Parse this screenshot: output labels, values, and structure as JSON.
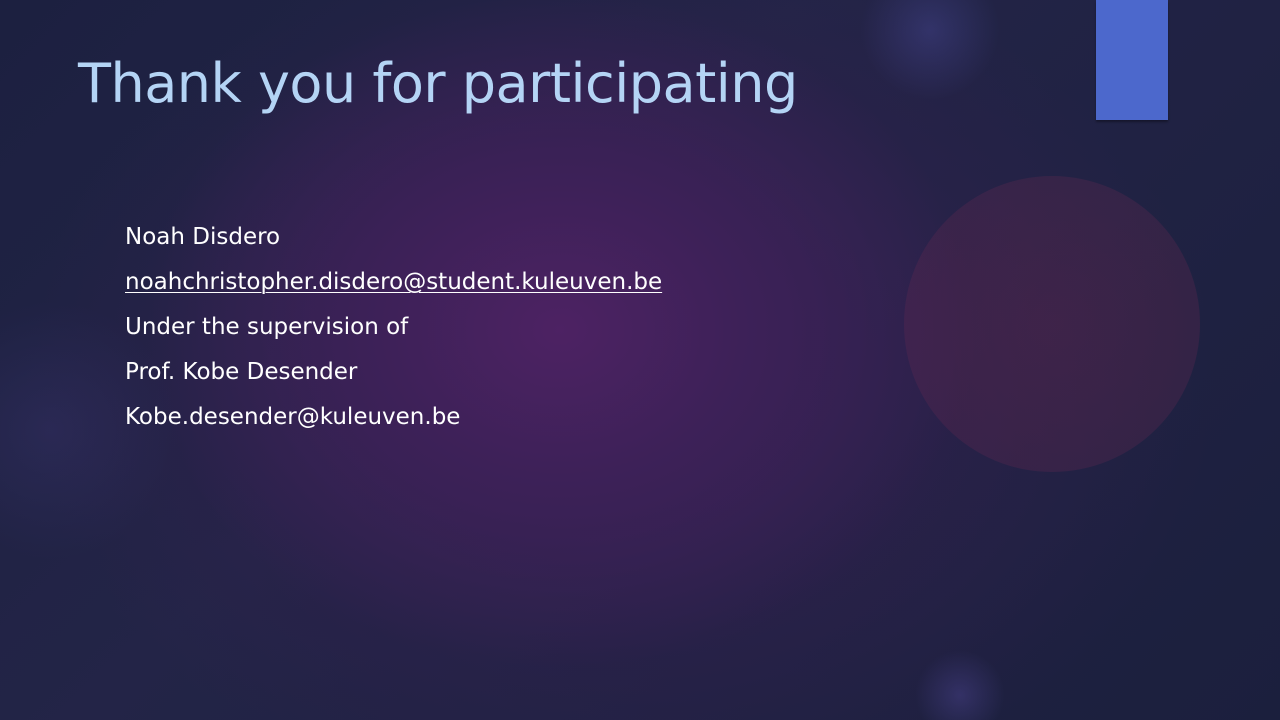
{
  "slide": {
    "title": "Thank you for participating",
    "lines": {
      "name": "Noah Disdero",
      "email": "noahchristopher.disdero@student.kuleuven.be",
      "supervision": "Under the supervision of",
      "supervisor": "Prof. Kobe Desender",
      "supervisor_email": "Kobe.desender@kuleuven.be"
    }
  },
  "colors": {
    "title": "#b4d4f5",
    "body_text": "#ffffff",
    "accent_bar": "#4c68cc",
    "background_center": "#4d2263",
    "background_edge": "#1c2040"
  }
}
